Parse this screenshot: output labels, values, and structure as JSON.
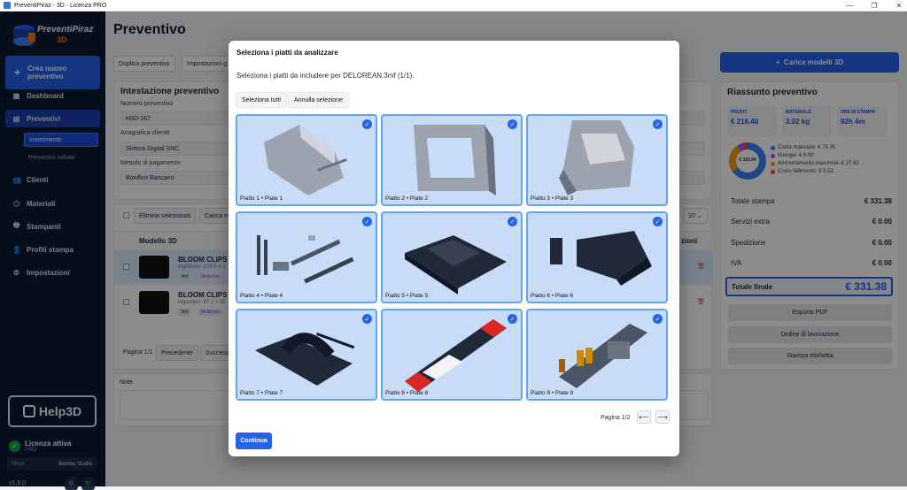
{
  "window": {
    "title": "PreventiPiraz - 3D - Licenza PRO",
    "min": "—",
    "max": "❐",
    "close": "✕"
  },
  "sidebar": {
    "logo_top": "PreventiPiraz",
    "logo_bottom": "3D",
    "new_quote": "Crea nuovo preventivo",
    "items": [
      {
        "label": "Dashboard",
        "icon": "▦"
      },
      {
        "label": "Preventivi",
        "icon": "▤"
      },
      {
        "label": "Clienti",
        "icon": "👥"
      },
      {
        "label": "Materiali",
        "icon": "⬡"
      },
      {
        "label": "Stampanti",
        "icon": "🖶"
      },
      {
        "label": "Profili stampa",
        "icon": "👤"
      },
      {
        "label": "Impostazioni",
        "icon": "⚙"
      }
    ],
    "sub_items": [
      "Inserimento",
      "Preventivi salvati"
    ],
    "help_logo": "Help3D",
    "license_title": "Licenza attiva",
    "license_type": "PRO",
    "slicer_label": "Slicer",
    "slicer_value": "Bambu Studio",
    "version": "v1.9.0"
  },
  "main": {
    "title": "Preventivo",
    "toolbar": [
      "Duplica preventivo",
      "Impostazioni g"
    ],
    "header_card": {
      "title": "Intestazione preventivo",
      "number_label": "Numero preventivo",
      "number": "H3D-167",
      "client_label": "Anagrafica cliente",
      "client": "Sintora Digital SNC",
      "payment_label": "Metodo di pagamento",
      "payment": "Bonifico Bancario"
    },
    "models": {
      "delete_selected": "Elimina selezionati",
      "load": "Carica m",
      "col_model": "Modello 3D",
      "col_actions": "zioni",
      "per_page": "10",
      "rows": [
        {
          "name": "BLOOM CLIPS",
          "dims": "Ingombro: 106.5 × 1",
          "tag1": "3mf",
          "tag2": "Multicolor"
        },
        {
          "name": "BLOOM CLIPS",
          "dims": "Ingombro: 87.1 × 11",
          "tag1": "3mf",
          "tag2": "Multicolor"
        }
      ],
      "page": "Pagina 1/1",
      "prev": "Precedente",
      "next": "Success"
    },
    "notes_label": "Note",
    "load_models": "Carica modelli 3D"
  },
  "summary": {
    "title": "Riassunto preventivo",
    "stats": [
      {
        "k": "PROFIT",
        "v": "€ 216.40"
      },
      {
        "k": "MATERIALE",
        "v": "3.02 kg"
      },
      {
        "k": "ORE DI STAMPA",
        "v": "92h 4m"
      }
    ],
    "donut_center": "€ 115.94",
    "legend": [
      {
        "label": "Costo materiale: € 75.90",
        "color": "#3b82f6"
      },
      {
        "label": "Energia: € 6.90",
        "color": "#a855f7"
      },
      {
        "label": "Ammortamento macchina: € 27.62",
        "color": "#f59e0b"
      },
      {
        "label": "Costo fallimento: € 5.52",
        "color": "#ef4444"
      }
    ],
    "rows": [
      {
        "k": "Totale stampa",
        "v": "€ 331.38"
      },
      {
        "k": "Servizi extra",
        "v": "€ 0.00"
      },
      {
        "k": "Spedizione",
        "v": "€ 0.00"
      },
      {
        "k": "IVA",
        "v": "€ 0.00"
      }
    ],
    "final_label": "Totale finale",
    "final_value": "€ 331.38",
    "buttons": [
      "Esporta PDF",
      "Ordine di lavorazione",
      "Stampa etichetta"
    ]
  },
  "modal": {
    "title": "Seleziona i piatti da analizzare",
    "desc": "Seleziona i piatti da includere per DELOREAN.3mf (1/1).",
    "select_all": "Seleziona tutti",
    "deselect": "Annulla selezione",
    "plates": [
      "Piatto 1 • Plate 1",
      "Piatto 2 • Plate 2",
      "Piatto 3 • Plate 3",
      "Piatto 4 • Plate 4",
      "Piatto 5 • Plate 5",
      "Piatto 6 • Plate 6",
      "Piatto 7 • Plate 7",
      "Piatto 8 • Plate 8",
      "Piatto 9 • Plate 9"
    ],
    "check": "✓",
    "page": "Pagina 1/2",
    "prev_arrow": "⟵",
    "next_arrow": "⟶",
    "continue": "Continua"
  }
}
